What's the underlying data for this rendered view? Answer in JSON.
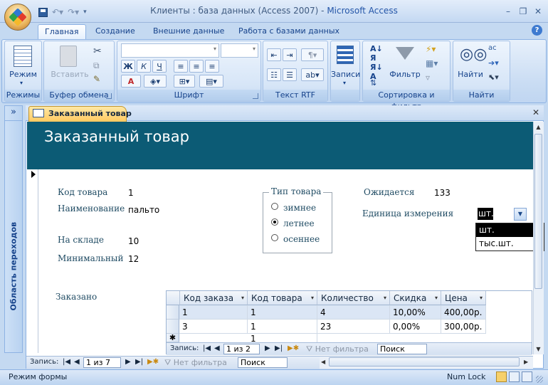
{
  "window": {
    "title_main": "Клиенты : база данных (Access 2007)",
    "title_sep": " - ",
    "title_app": "Microsoft Access",
    "qat": [
      "save-icon",
      "undo-icon",
      "redo-icon",
      "customize-icon"
    ]
  },
  "tabs": [
    "Главная",
    "Создание",
    "Внешние данные",
    "Работа с базами данных"
  ],
  "ribbon": {
    "groups": {
      "views": {
        "label": "Режимы",
        "button": "Режим"
      },
      "clipboard": {
        "label": "Буфер обмена",
        "paste": "Вставить"
      },
      "font": {
        "label": "Шрифт",
        "bold": "Ж",
        "italic": "К",
        "underline": "Ч",
        "fontcolor": "А"
      },
      "rtf": {
        "label": "Текст RTF"
      },
      "records": {
        "label": "",
        "button": "Записи"
      },
      "sort": {
        "label": "Сортировка и фильтр",
        "filter": "Фильтр"
      },
      "find": {
        "label": "Найти",
        "button": "Найти"
      }
    }
  },
  "nav_pane": {
    "label": "Область переходов",
    "chevron": "»"
  },
  "document": {
    "tab_label": "Заказанный товар",
    "header_title": "Заказанный товар",
    "fields": {
      "code_label": "Код товара",
      "code_value": "1",
      "name_label": "Наименование",
      "name_value": "пальто",
      "stock_label": "На складе",
      "stock_value": "10",
      "min_label": "Минимальный",
      "min_value": "12",
      "expected_label": "Ожидается",
      "expected_value": "133",
      "unit_label": "Единица измерения",
      "unit_value": "шт."
    },
    "type_group": {
      "title": "Тип товара",
      "options": [
        "зимнее",
        "летнее",
        "осеннее"
      ],
      "selected_index": 1
    },
    "unit_dropdown": [
      "шт.",
      "тыс.шт."
    ],
    "ordered_label": "Заказано",
    "subform": {
      "columns": [
        "Код заказа",
        "Код товара",
        "Количество",
        "Скидка",
        "Цена"
      ],
      "rows": [
        [
          "1",
          "1",
          "4",
          "10,00%",
          "400,00р."
        ],
        [
          "3",
          "1",
          "23",
          "0,00%",
          "300,00р."
        ]
      ],
      "new_row": [
        "",
        "1",
        "",
        "",
        ""
      ],
      "nav": {
        "records_label": "Запись:",
        "position": "1 из 2",
        "filter": "Нет фильтра",
        "search": "Поиск"
      }
    },
    "nav": {
      "records_label": "Запись:",
      "position": "1 из 7",
      "filter": "Нет фильтра",
      "search": "Поиск"
    }
  },
  "statusbar": {
    "mode": "Режим формы",
    "numlock": "Num Lock"
  }
}
